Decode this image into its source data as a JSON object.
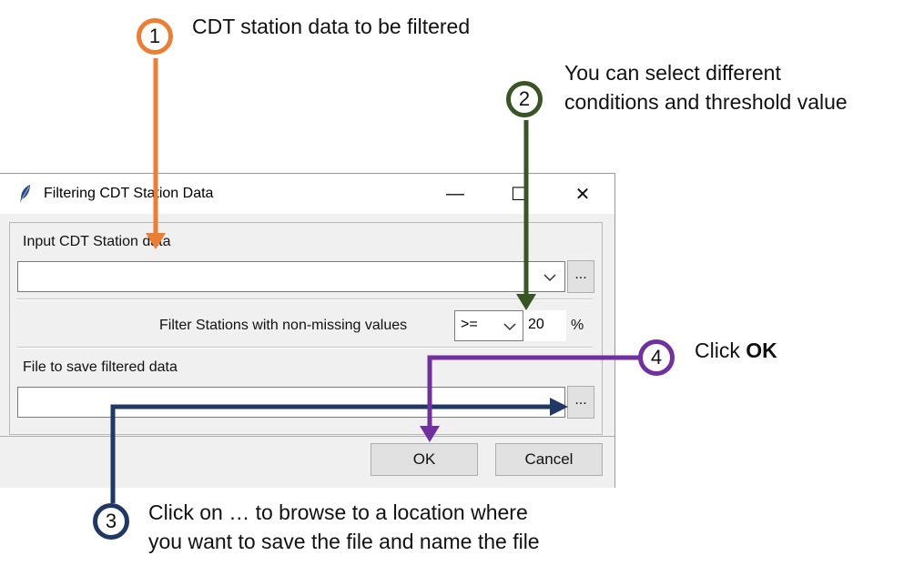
{
  "window": {
    "title": "Filtering CDT Station Data",
    "controls": {
      "minimize": "—",
      "maximize": "☐",
      "close": "✕"
    }
  },
  "input_section": {
    "label": "Input CDT Station data",
    "value": "",
    "browse_label": "..."
  },
  "filter_row": {
    "label": "Filter Stations with non-missing values",
    "condition": ">=",
    "threshold": "20",
    "unit": "%"
  },
  "output_section": {
    "label": "File to save filtered data",
    "value": "",
    "browse_label": "..."
  },
  "buttons": {
    "ok": "OK",
    "cancel": "Cancel"
  },
  "annotations": [
    {
      "number": "1",
      "text": "CDT station data to be filtered",
      "color": "#ed7d31"
    },
    {
      "number": "2",
      "text": "You can select different\nconditions and threshold value",
      "color": "#375623"
    },
    {
      "number": "3",
      "text": "Click on … to browse to a location where\nyou want to save the file and name the file",
      "color": "#1f3864"
    },
    {
      "number": "4",
      "text_prefix": "Click ",
      "text_bold": "OK",
      "color": "#7030a0"
    }
  ]
}
